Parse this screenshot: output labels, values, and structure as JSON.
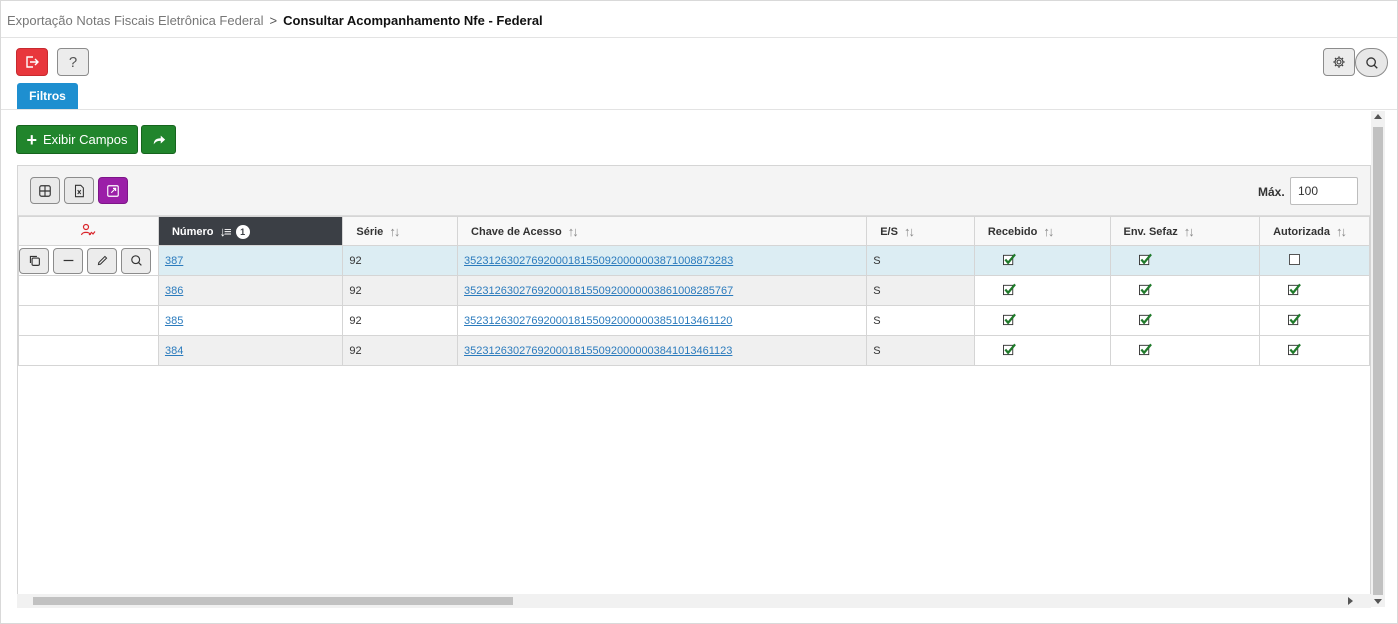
{
  "breadcrumb": {
    "parent": "Exportação Notas Fiscais Eletrônica Federal",
    "separator": ">",
    "current": "Consultar Acompanhamento Nfe - Federal"
  },
  "toolbar": {
    "help_label": "?"
  },
  "tabs": {
    "filtros": "Filtros"
  },
  "actions": {
    "exibir_campos": "Exibir Campos"
  },
  "grid": {
    "max_label": "Máx.",
    "max_value": "100",
    "columns": [
      {
        "label": "Número",
        "badge": "1"
      },
      {
        "label": "Série"
      },
      {
        "label": "Chave de Acesso"
      },
      {
        "label": "E/S"
      },
      {
        "label": "Recebido"
      },
      {
        "label": "Env. Sefaz"
      },
      {
        "label": "Autorizada"
      }
    ],
    "rows": [
      {
        "numero": "387",
        "serie": "92",
        "chave": "35231263027692000181550920000003871008873283",
        "es": "S",
        "recebido": true,
        "env_sefaz": true,
        "autorizada": false
      },
      {
        "numero": "386",
        "serie": "92",
        "chave": "35231263027692000181550920000003861008285767",
        "es": "S",
        "recebido": true,
        "env_sefaz": true,
        "autorizada": true
      },
      {
        "numero": "385",
        "serie": "92",
        "chave": "35231263027692000181550920000003851013461120",
        "es": "S",
        "recebido": true,
        "env_sefaz": true,
        "autorizada": true
      },
      {
        "numero": "384",
        "serie": "92",
        "chave": "35231263027692000181550920000003841013461123",
        "es": "S",
        "recebido": true,
        "env_sefaz": true,
        "autorizada": true
      }
    ]
  },
  "colors": {
    "accent_blue": "#1e8fd0",
    "exit_red": "#e8373d",
    "action_green": "#21852c",
    "purple": "#9b1fa8",
    "link": "#2b7bbd",
    "selected_row": "#dcedf3"
  },
  "icons": {
    "exit": "logout-icon",
    "help": "question-icon",
    "settings": "gear-icon",
    "search": "search-icon",
    "share": "share-arrow-icon",
    "columns": "grid-icon",
    "excel": "excel-file-icon",
    "expand": "expand-icon",
    "user_sign": "user-signature-icon",
    "copy": "copy-icon",
    "remove": "minus-icon",
    "edit": "pencil-icon",
    "view": "magnifier-icon"
  }
}
